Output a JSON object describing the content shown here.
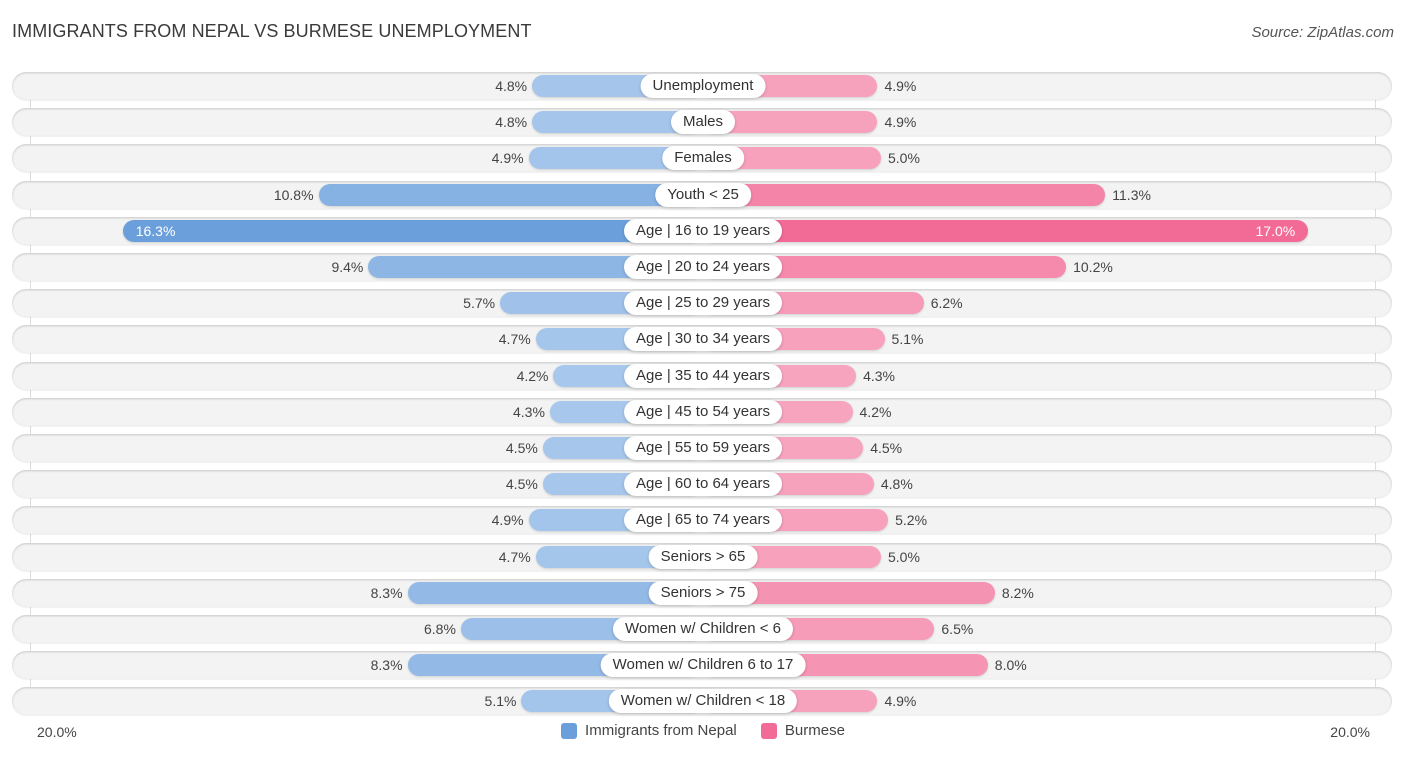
{
  "header": {
    "title": "IMMIGRANTS FROM NEPAL VS BURMESE UNEMPLOYMENT",
    "source": "Source: ZipAtlas.com"
  },
  "colors": {
    "nepal": "#6a9fdc",
    "nepal_light": "#a9c8ec",
    "burmese": "#f26b96",
    "burmese_light": "#f7a6c0"
  },
  "chart_data": {
    "type": "bar",
    "orientation": "horizontal-diverging",
    "title": "IMMIGRANTS FROM NEPAL VS BURMESE UNEMPLOYMENT",
    "categories": [
      "Unemployment",
      "Males",
      "Females",
      "Youth < 25",
      "Age | 16 to 19 years",
      "Age | 20 to 24 years",
      "Age | 25 to 29 years",
      "Age | 30 to 34 years",
      "Age | 35 to 44 years",
      "Age | 45 to 54 years",
      "Age | 55 to 59 years",
      "Age | 60 to 64 years",
      "Age | 65 to 74 years",
      "Seniors > 65",
      "Seniors > 75",
      "Women w/ Children < 6",
      "Women w/ Children 6 to 17",
      "Women w/ Children < 18"
    ],
    "series": [
      {
        "name": "Immigrants from Nepal",
        "side": "left",
        "values": [
          4.8,
          4.8,
          4.9,
          10.8,
          16.3,
          9.4,
          5.7,
          4.7,
          4.2,
          4.3,
          4.5,
          4.5,
          4.9,
          4.7,
          8.3,
          6.8,
          8.3,
          5.1
        ]
      },
      {
        "name": "Burmese",
        "side": "right",
        "values": [
          4.9,
          4.9,
          5.0,
          11.3,
          17.0,
          10.2,
          6.2,
          5.1,
          4.3,
          4.2,
          4.5,
          4.8,
          5.2,
          5.0,
          8.2,
          6.5,
          8.0,
          4.9
        ]
      }
    ],
    "value_format": "percent_1dp",
    "axis": {
      "min_label": "20.0%",
      "max_label": "20.0%",
      "range": [
        -20,
        20
      ]
    },
    "legend": {
      "position": "bottom-center",
      "entries": [
        "Immigrants from Nepal",
        "Burmese"
      ]
    },
    "grid": false
  }
}
